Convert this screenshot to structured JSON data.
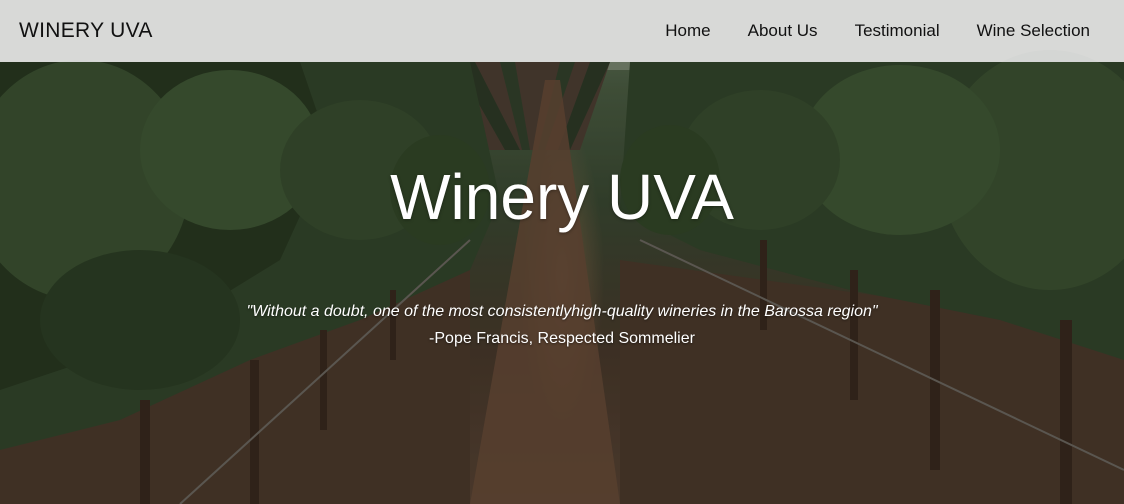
{
  "navbar": {
    "brand": "WINERY UVA",
    "links": [
      {
        "label": "Home"
      },
      {
        "label": "About Us"
      },
      {
        "label": "Testimonial"
      },
      {
        "label": "Wine Selection"
      }
    ]
  },
  "hero": {
    "title": "Winery UVA",
    "quote": "\"Without a doubt, one of the most consistentlyhigh-quality wineries in the Barossa region\"",
    "attribution": "-Pope Francis, Respected Sommelier",
    "background_image": "vineyard rows"
  },
  "colors": {
    "navbar_bg": "#e1e1e1",
    "text_dark": "#111111",
    "text_light": "#ffffff",
    "foliage": "#3b4a33",
    "soil": "#5a4535"
  }
}
